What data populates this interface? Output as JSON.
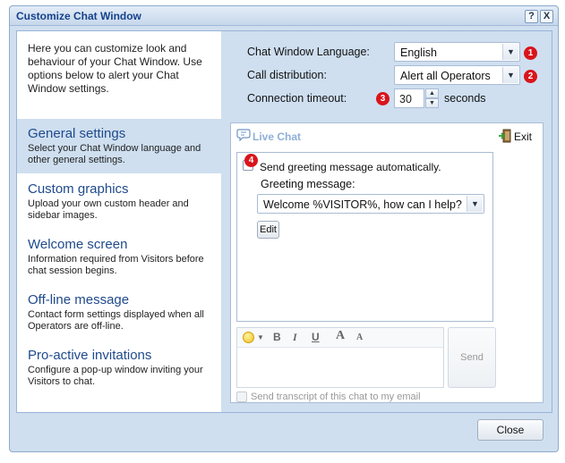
{
  "window": {
    "title": "Customize Chat Window",
    "help": "?",
    "close": "X"
  },
  "sidebar": {
    "intro": "Here you can customize look and behaviour of your Chat Window. Use options below to alert your Chat Window settings.",
    "items": [
      {
        "title": "General settings",
        "desc": "Select your Chat Window language and other general settings."
      },
      {
        "title": "Custom graphics",
        "desc": "Upload your own custom header and sidebar images."
      },
      {
        "title": "Welcome screen",
        "desc": "Information required from Visitors before chat session begins."
      },
      {
        "title": "Off-line message",
        "desc": "Contact form settings displayed when all Operators are off-line."
      },
      {
        "title": "Pro-active invitations",
        "desc": "Configure a pop-up window inviting your Visitors to chat."
      }
    ]
  },
  "settings": {
    "language_label": "Chat Window Language:",
    "language_value": "English",
    "distribution_label": "Call distribution:",
    "distribution_value": "Alert all Operators",
    "timeout_label": "Connection timeout:",
    "timeout_value": "30",
    "timeout_unit": "seconds",
    "badges": [
      "1",
      "2",
      "3",
      "4"
    ]
  },
  "preview": {
    "live_chat": "Live Chat",
    "exit": "Exit",
    "send_greeting_label": "Send greeting message automatically.",
    "greeting_label": "Greeting message:",
    "greeting_value": "Welcome %VISITOR%, how can I help?",
    "edit": "Edit",
    "toolbar": {
      "bold": "B",
      "italic": "I",
      "underline": "U",
      "grow": "A",
      "shrink": "A"
    },
    "send": "Send",
    "transcript_label": "Send transcript of this chat to my email"
  },
  "footer": {
    "close": "Close"
  },
  "colors": {
    "accent": "#1f4a8c",
    "badge": "#d9141b",
    "panel_bg": "#cfdff0"
  }
}
